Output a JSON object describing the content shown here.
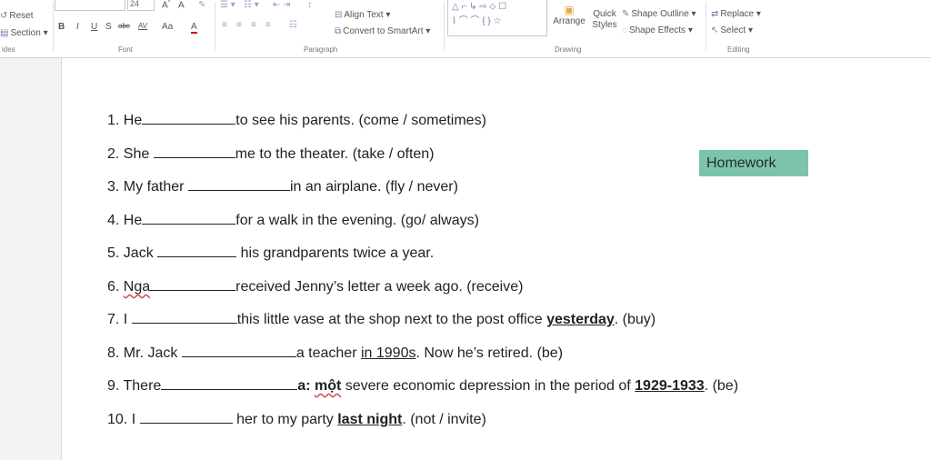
{
  "ribbon": {
    "slides": {
      "reset_label": "Reset",
      "section_label": "Section",
      "group_label": "ides"
    },
    "font": {
      "size_value": "24",
      "bold": "B",
      "italic": "I",
      "underline": "U",
      "shadow": "S",
      "strike": "abc",
      "spacing": "AV",
      "case": "Aa",
      "color": "A",
      "group_label": "Font"
    },
    "paragraph": {
      "align_text_label": "Align Text",
      "convert_label": "Convert to SmartArt",
      "group_label": "Paragraph"
    },
    "drawing": {
      "arrange_label": "Arrange",
      "quick_styles_label": "Quick Styles",
      "shape_outline_label": "Shape Outline",
      "shape_effects_label": "Shape Effects",
      "group_label": "Drawing"
    },
    "editing": {
      "replace_label": "Replace",
      "select_label": "Select",
      "group_label": "Editing"
    }
  },
  "exercise": {
    "l1": {
      "num": "1.",
      "subject": "He",
      "rest": "to see his parents. (come / sometimes)"
    },
    "l2": {
      "num": "2.",
      "subject": "She",
      "rest": "me to the theater. (take / often)"
    },
    "l3": {
      "num": "3.",
      "subject": "My father",
      "rest": "in an airplane. (fly / never)"
    },
    "l4": {
      "num": "4.",
      "subject": "He",
      "rest": "for a walk in the evening. (go/ always)"
    },
    "l5": {
      "num": "5.",
      "subject": "Jack",
      "rest": "his grandparents twice a year."
    },
    "l6": {
      "num": "6.",
      "subject": "Nga",
      "rest": "received Jenny’s letter a week ago. (receive)"
    },
    "l7": {
      "num": "7.",
      "subject": "I",
      "rest_a": "this little vase at the shop next to the post office ",
      "bold": "yesterday",
      "rest_b": ". (buy)"
    },
    "l8": {
      "num": "8.",
      "subject": "Mr. Jack",
      "rest_a": "a teacher ",
      "under": "in 1990s",
      "rest_b": ". Now he’s retired. (be)"
    },
    "l9": {
      "num": "9.",
      "subject": "There",
      "bold_a": "a: ",
      "bold_b": "một",
      "rest_a": " severe economic depression in the period of ",
      "bold_c": "1929-1933",
      "rest_b": ". (be)"
    },
    "l10": {
      "num": "10.",
      "subject": "I",
      "rest_a": "her to my party ",
      "bold": "last night",
      "rest_b": ". (not / invite)"
    }
  },
  "homework_label": "Homework",
  "colors": {
    "homework_bg": "#7cc4a9",
    "ribbon_bg": "#ffffff",
    "sidebar_bg": "#f3f3f3"
  }
}
